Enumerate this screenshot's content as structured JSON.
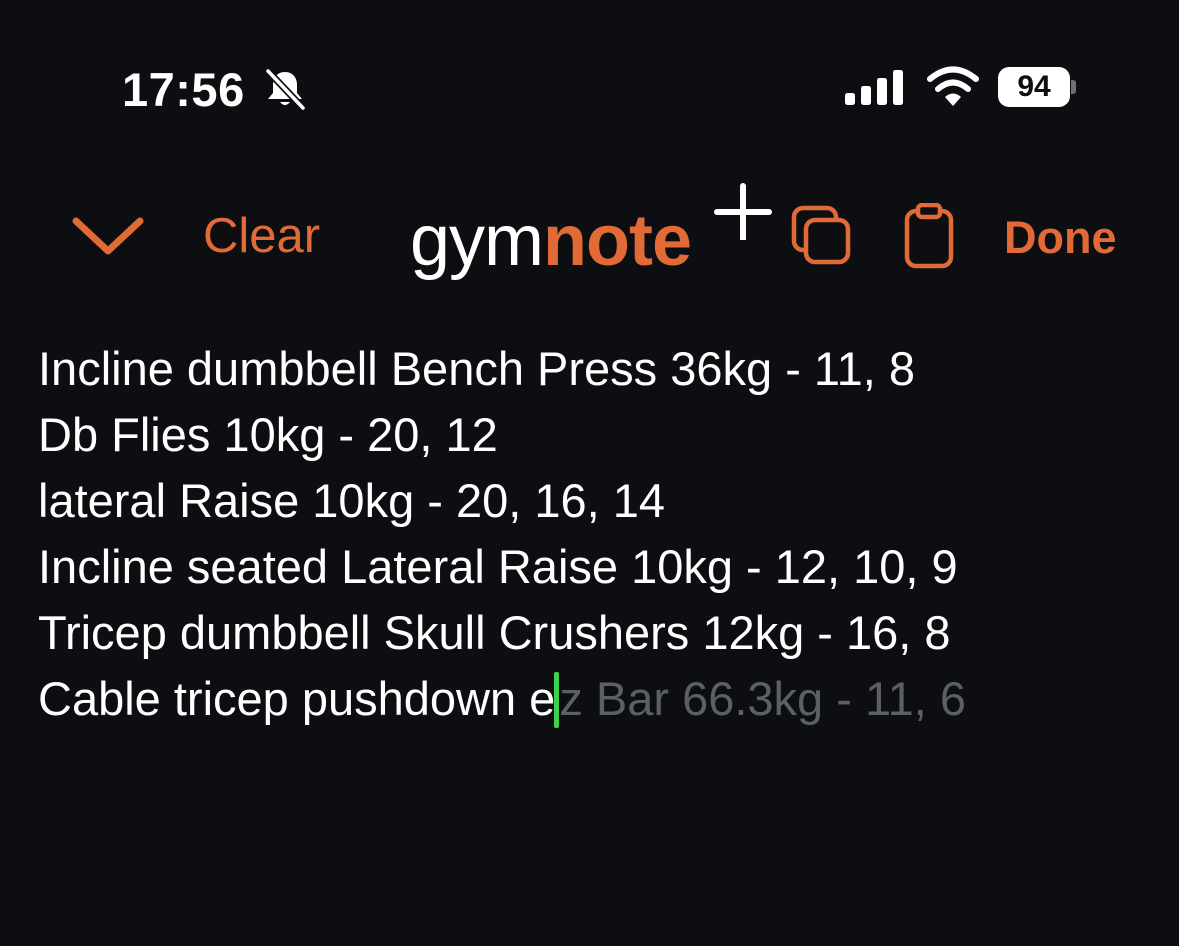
{
  "status_bar": {
    "time": "17:56",
    "silent_icon": "bell-slash-icon",
    "signal_icon": "cellular-signal-icon",
    "wifi_icon": "wifi-icon",
    "battery_percent": "94"
  },
  "toolbar": {
    "collapse_icon": "chevron-down-icon",
    "clear_label": "Clear",
    "logo": {
      "part1": "gym",
      "part2": "note",
      "plus": "+"
    },
    "copy_icon": "copy-icon",
    "clipboard_icon": "clipboard-icon",
    "done_label": "Done"
  },
  "colors": {
    "accent": "#e26a37",
    "background": "#0c0e12",
    "caret": "#3fd14a",
    "suggestion": "#5c5f66"
  },
  "note": {
    "lines": [
      "Incline dumbbell Bench Press 36kg - 11, 8",
      "Db Flies 10kg - 20, 12",
      "lateral Raise 10kg - 20, 16, 14",
      "Incline seated Lateral Raise 10kg - 12, 10, 9",
      "Tricep dumbbell Skull Crushers 12kg - 16, 8"
    ],
    "current_line_typed": "Cable tricep pushdown e",
    "current_line_suggestion": "z Bar 66.3kg - 11, 6"
  }
}
